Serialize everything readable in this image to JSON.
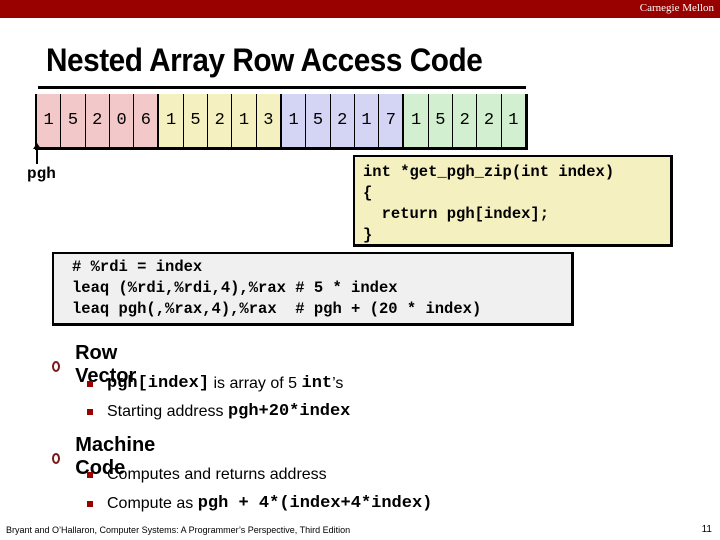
{
  "header": {
    "brand": "Carnegie Mellon"
  },
  "slide": {
    "title": "Nested Array Row Access Code"
  },
  "colors": {
    "topbar": "#990000",
    "row_colors": [
      "#f2c8c8",
      "#f5f0c0",
      "#d4d4f4",
      "#d2efd0"
    ],
    "code_box_bg": "#f5f0c0",
    "asm_box_bg": "#f0f0f0",
    "bullet": "#990000"
  },
  "array": {
    "label": "pgh",
    "rows": [
      [
        "1",
        "5",
        "2",
        "0",
        "6"
      ],
      [
        "1",
        "5",
        "2",
        "1",
        "3"
      ],
      [
        "1",
        "5",
        "2",
        "1",
        "7"
      ],
      [
        "1",
        "5",
        "2",
        "2",
        "1"
      ]
    ]
  },
  "c_code": {
    "lines": [
      "int *get_pgh_zip(int index)",
      "{",
      "  return pgh[index];",
      "}"
    ]
  },
  "asm_code": {
    "lines": [
      "# %rdi = index",
      "leaq (%rdi,%rdi,4),%rax # 5 * index",
      "leaq pgh(,%rax,4),%rax  # pgh + (20 * index)"
    ]
  },
  "bullets": [
    {
      "heading": "Row Vector",
      "items": [
        {
          "parts": [
            {
              "text": "pgh[index]",
              "mono": true
            },
            {
              "text": " is array of 5 ",
              "mono": false
            },
            {
              "text": "int",
              "mono": true
            },
            {
              "text": "’s",
              "mono": false
            }
          ]
        },
        {
          "parts": [
            {
              "text": "Starting address ",
              "mono": false
            },
            {
              "text": "pgh+20*index",
              "mono": true
            }
          ]
        }
      ]
    },
    {
      "heading": "Machine Code",
      "items": [
        {
          "parts": [
            {
              "text": "Computes and returns address",
              "mono": false
            }
          ]
        },
        {
          "parts": [
            {
              "text": "Compute as ",
              "mono": false
            },
            {
              "text": "pgh + 4*(index+4*index)",
              "mono": true
            }
          ]
        }
      ]
    }
  ],
  "footer": {
    "citation": "Bryant and O’Hallaron, Computer Systems: A Programmer’s Perspective, Third Edition",
    "page_number": "11"
  }
}
